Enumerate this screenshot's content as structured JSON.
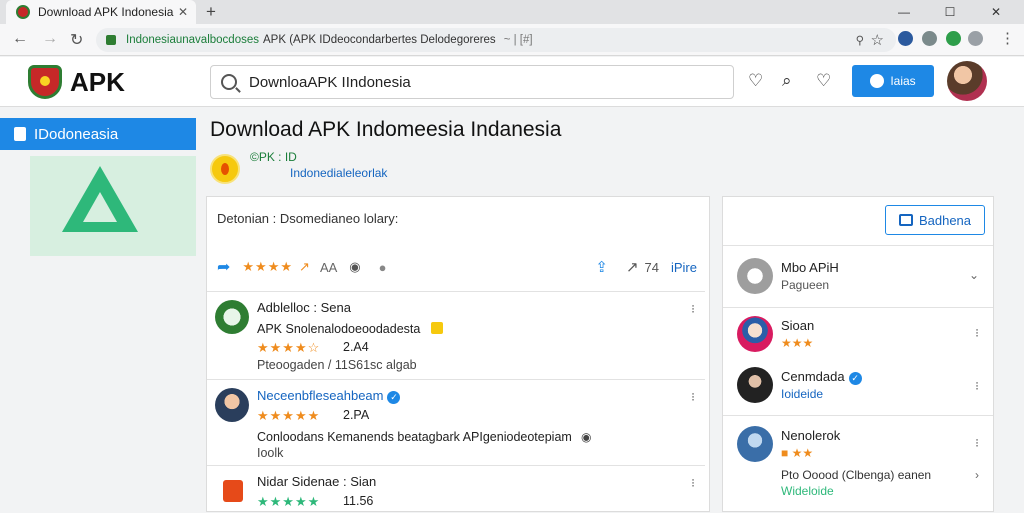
{
  "browser": {
    "tab_title": "Download APK Indonesia",
    "tab_close": "✕",
    "new_tab": "+",
    "url_green": "Indonesiaunavalbocdoses",
    "url_rest": "APK (APK IDdeocondarbertes Delodegoreres",
    "url_suffix": "~ | [#]",
    "win_min": "—",
    "win_max": "☐",
    "win_close": "✕",
    "key_icon": "⚲",
    "star_icon": "☆"
  },
  "header": {
    "logo_text": "APK",
    "search_value": "DownloaAPK IIndonesia",
    "button_label": "Iaias"
  },
  "sidebar": {
    "title": "IDodoneasia"
  },
  "main": {
    "title": "Download APK Indomeesia Indanesia",
    "meta_line1": "©PK : ID",
    "meta_line2": "Indonedialeleorlak",
    "description": "Detonian : Dsomedianeo lolary:",
    "rating_count": "AA",
    "stat_count": "74",
    "stat_label": "iPire"
  },
  "reviews": [
    {
      "name": "Adblelloc : Sena",
      "text": "APK Snolenalodoeoodadesta",
      "stars": "★★★★☆",
      "rating": "2.A4",
      "sub": "Pteoogaden / 11S61sc algab"
    },
    {
      "name": "Neceenbfleseahbeam",
      "stars": "★★★★★",
      "rating": "2.PA",
      "text": "Conloodans Kemanends beatagbark APIgeniodeotepiam",
      "sub": "Ioolk"
    },
    {
      "name": "Nidar Sidenae : Sian",
      "stars": "★★★★★",
      "rating": "11.56"
    }
  ],
  "right_panel": {
    "button_label": "Badhena",
    "items": [
      {
        "name": "Mbo APiH",
        "sub": "Pagueen"
      },
      {
        "name": "Sioan",
        "sub": "★★★"
      },
      {
        "name": "Cenmdada",
        "sub": "Ioideide"
      },
      {
        "name": "Nenolerok",
        "sub": "Pto Ooood (Clbenga) eanen",
        "extra": "Wideloide"
      }
    ]
  },
  "colors": {
    "accent": "#1e88e5",
    "green": "#1b7e3a",
    "star": "#ef8c1e"
  }
}
